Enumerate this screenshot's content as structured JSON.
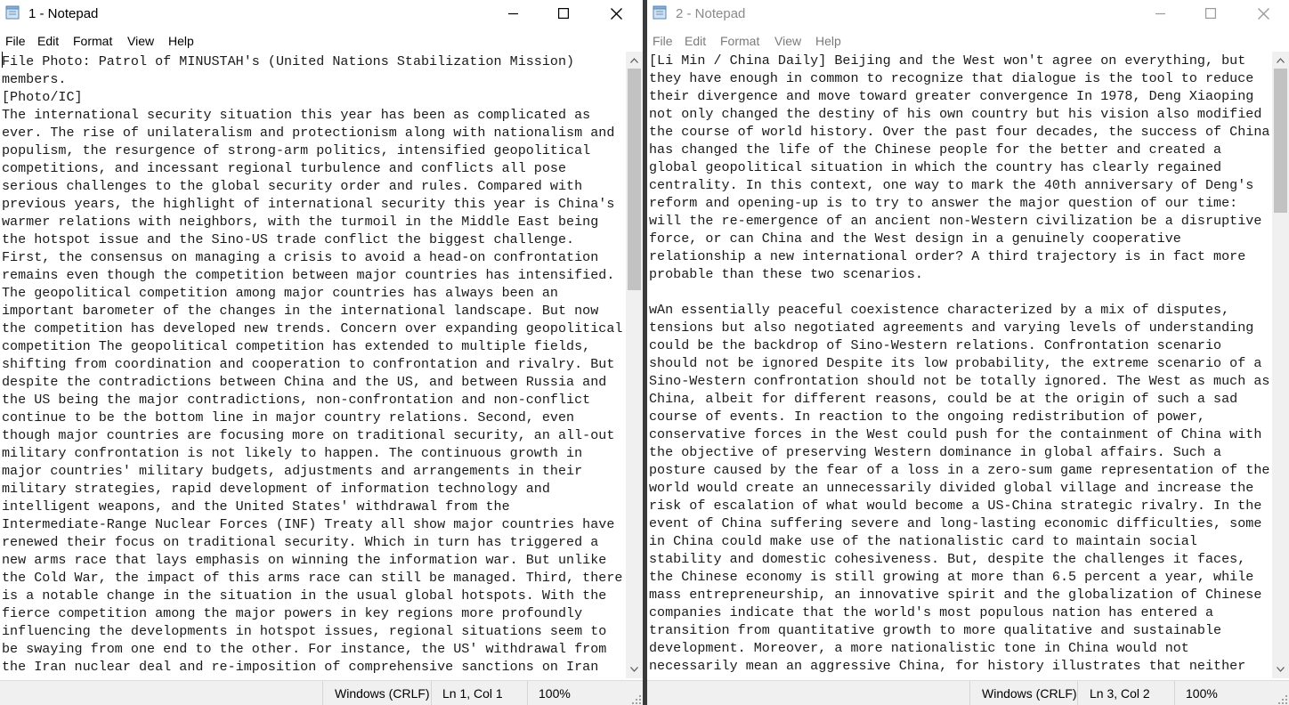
{
  "left": {
    "title": "1 - Notepad",
    "menu": [
      "File",
      "Edit",
      "Format",
      "View",
      "Help"
    ],
    "text": "File Photo: Patrol of MINUSTAH's (United Nations Stabilization Mission)\nmembers.\n[Photo/IC]\nThe international security situation this year has been as complicated as\never. The rise of unilateralism and protectionism along with nationalism and\npopulism, the resurgence of strong-arm politics, intensified geopolitical\ncompetitions, and incessant regional turbulence and conflicts all pose\nserious challenges to the global security order and rules. Compared with\nprevious years, the highlight of international security this year is China's\nwarmer relations with neighbors, with the turmoil in the Middle East being\nthe hotspot issue and the Sino-US trade conflict the biggest challenge.\nFirst, the consensus on managing a crisis to avoid a head-on confrontation\nremains even though the competition between major countries has intensified.\nThe geopolitical competition among major countries has always been an\nimportant barometer of the changes in the international landscape. But now\nthe competition has developed new trends. Concern over expanding geopolitical\ncompetition The geopolitical competition has extended to multiple fields,\nshifting from coordination and cooperation to confrontation and rivalry. But\ndespite the contradictions between China and the US, and between Russia and\nthe US being the major contradictions, non-confrontation and non-conflict\ncontinue to be the bottom line in major country relations. Second, even\nthough major countries are focusing more on traditional security, an all-out\nmilitary confrontation is not likely to happen. The continuous growth in\nmajor countries' military budgets, adjustments and arrangements in their\nmilitary strategies, rapid development of information technology and\nintelligent weapons, and the United States' withdrawal from the\nIntermediate-Range Nuclear Forces (INF) Treaty all show major countries have\nrenewed their focus on traditional security. Which in turn has triggered a\nnew arms race that lays emphasis on winning the information war. But unlike\nthe Cold War, the impact of this arms race can still be managed. Third, there\nis a notable change in the situation in the usual global hotspots. With the\nfierce competition among the major powers in key regions more profoundly\ninfluencing the developments in hotspot issues, regional situations seem to\nbe swaying from one end to the other. For instance, the US' withdrawal from\nthe Iran nuclear deal and re-imposition of comprehensive sanctions on Iran",
    "status": {
      "encoding": "Windows (CRLF)",
      "position": "Ln 1, Col 1",
      "zoom": "100%"
    }
  },
  "right": {
    "title": "2 - Notepad",
    "menu": [
      "File",
      "Edit",
      "Format",
      "View",
      "Help"
    ],
    "text": "[Li Min / China Daily] Beijing and the West won't agree on everything, but\nthey have enough in common to recognize that dialogue is the tool to reduce\ntheir divergence and move toward greater convergence In 1978, Deng Xiaoping\nnot only changed the destiny of his own country but his vision also modified\nthe course of world history. Over the past four decades, the success of China\nhas changed the life of the Chinese people for the better and created a\nglobal geopolitical situation in which the country has clearly regained\ncentrality. In this context, one way to mark the 40th anniversary of Deng's\nreform and opening-up is to try to answer the major question of our time:\nwill the re-emergence of an ancient non-Western civilization be a disruptive\nforce, or can China and the West design in a genuinely cooperative\nrelationship a new international order? A third trajectory is in fact more\nprobable than these two scenarios.\n\nwAn essentially peaceful coexistence characterized by a mix of disputes,\ntensions but also negotiated agreements and varying levels of understanding\ncould be the backdrop of Sino-Western relations. Confrontation scenario\nshould not be ignored Despite its low probability, the extreme scenario of a\nSino-Western confrontation should not be totally ignored. The West as much as\nChina, albeit for different reasons, could be at the origin of such a sad\ncourse of events. In reaction to the ongoing redistribution of power,\nconservative forces in the West could push for the containment of China with\nthe objective of preserving Western dominance in global affairs. Such a\nposture caused by the fear of a loss in a zero-sum game representation of the\nworld would create an unnecessarily divided global village and increase the\nrisk of escalation of what would become a US-China strategic rivalry. In the\nevent of China suffering severe and long-lasting economic difficulties, some\nin China could make use of the nationalistic card to maintain social\nstability and domestic cohesiveness. But, despite the challenges it faces,\nthe Chinese economy is still growing at more than 6.5 percent a year, while\nmass entrepreneurship, an innovative spirit and the globalization of Chinese\ncompanies indicate that the world's most populous nation has entered a\ntransition from quantitative growth to more qualitative and sustainable\ndevelopment. Moreover, a more nationalistic tone in China would not\nnecessarily mean an aggressive China, for history illustrates that neither",
    "status": {
      "encoding": "Windows (CRLF)",
      "position": "Ln 3, Col 2",
      "zoom": "100%"
    }
  },
  "icons": {
    "app": "notepad-icon",
    "minimize": "minimize-icon",
    "maximize": "maximize-icon",
    "close": "close-icon"
  }
}
